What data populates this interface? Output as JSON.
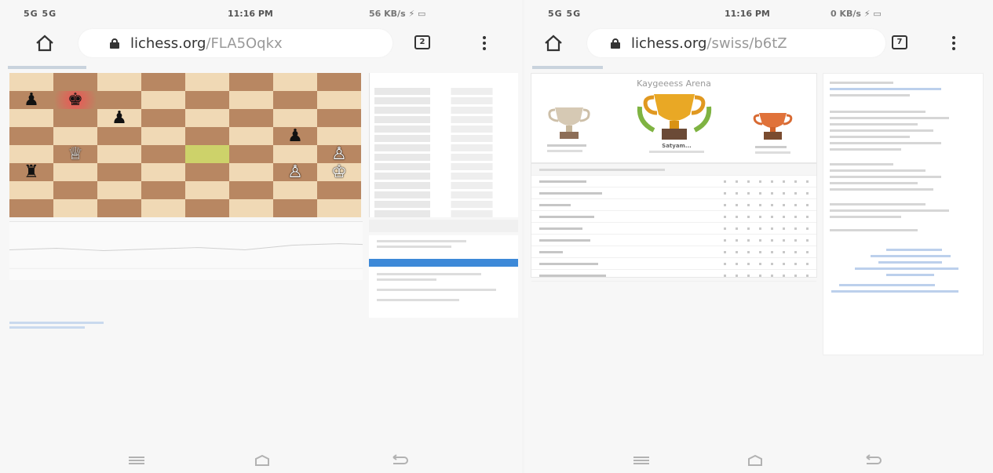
{
  "left_screen": {
    "status": {
      "carrier": "5G 5G",
      "time": "11:16 PM",
      "indicators": "56 KB/s ⚡ ▭"
    },
    "url": {
      "host": "lichess.org",
      "path": "/FLA5Oqkx",
      "tabs_count": "2"
    }
  },
  "right_screen": {
    "status": {
      "carrier": "5G 5G",
      "time": "11:16 PM",
      "indicators": "0 KB/s ⚡ ▭"
    },
    "url": {
      "host": "lichess.org",
      "path": "/swiss/b6tZ",
      "tabs_count": "7"
    },
    "podium_title": "Kaygeeess Arena",
    "winner": "Satyam..."
  },
  "board": [
    [
      "",
      "",
      "",
      "",
      "",
      "",
      "",
      ""
    ],
    [
      "♟",
      "♚",
      "",
      "",
      "",
      "",
      "",
      ""
    ],
    [
      "",
      "",
      "♟",
      "",
      "",
      "",
      "",
      ""
    ],
    [
      "",
      "",
      "",
      "",
      "",
      "",
      "♟",
      ""
    ],
    [
      "",
      "♕",
      "",
      "",
      "",
      "",
      "",
      "♙"
    ],
    [
      "♜",
      "",
      "",
      "",
      "",
      "",
      "♙",
      "♔"
    ],
    [
      "",
      "",
      "",
      "",
      "",
      "",
      "",
      ""
    ],
    [
      "",
      "",
      "",
      "",
      "",
      "",
      "",
      ""
    ]
  ],
  "colors": {
    "light": "#f0d9b5",
    "dark": "#b88762",
    "accent": "#3d89d8",
    "gold": "#e9a825"
  }
}
